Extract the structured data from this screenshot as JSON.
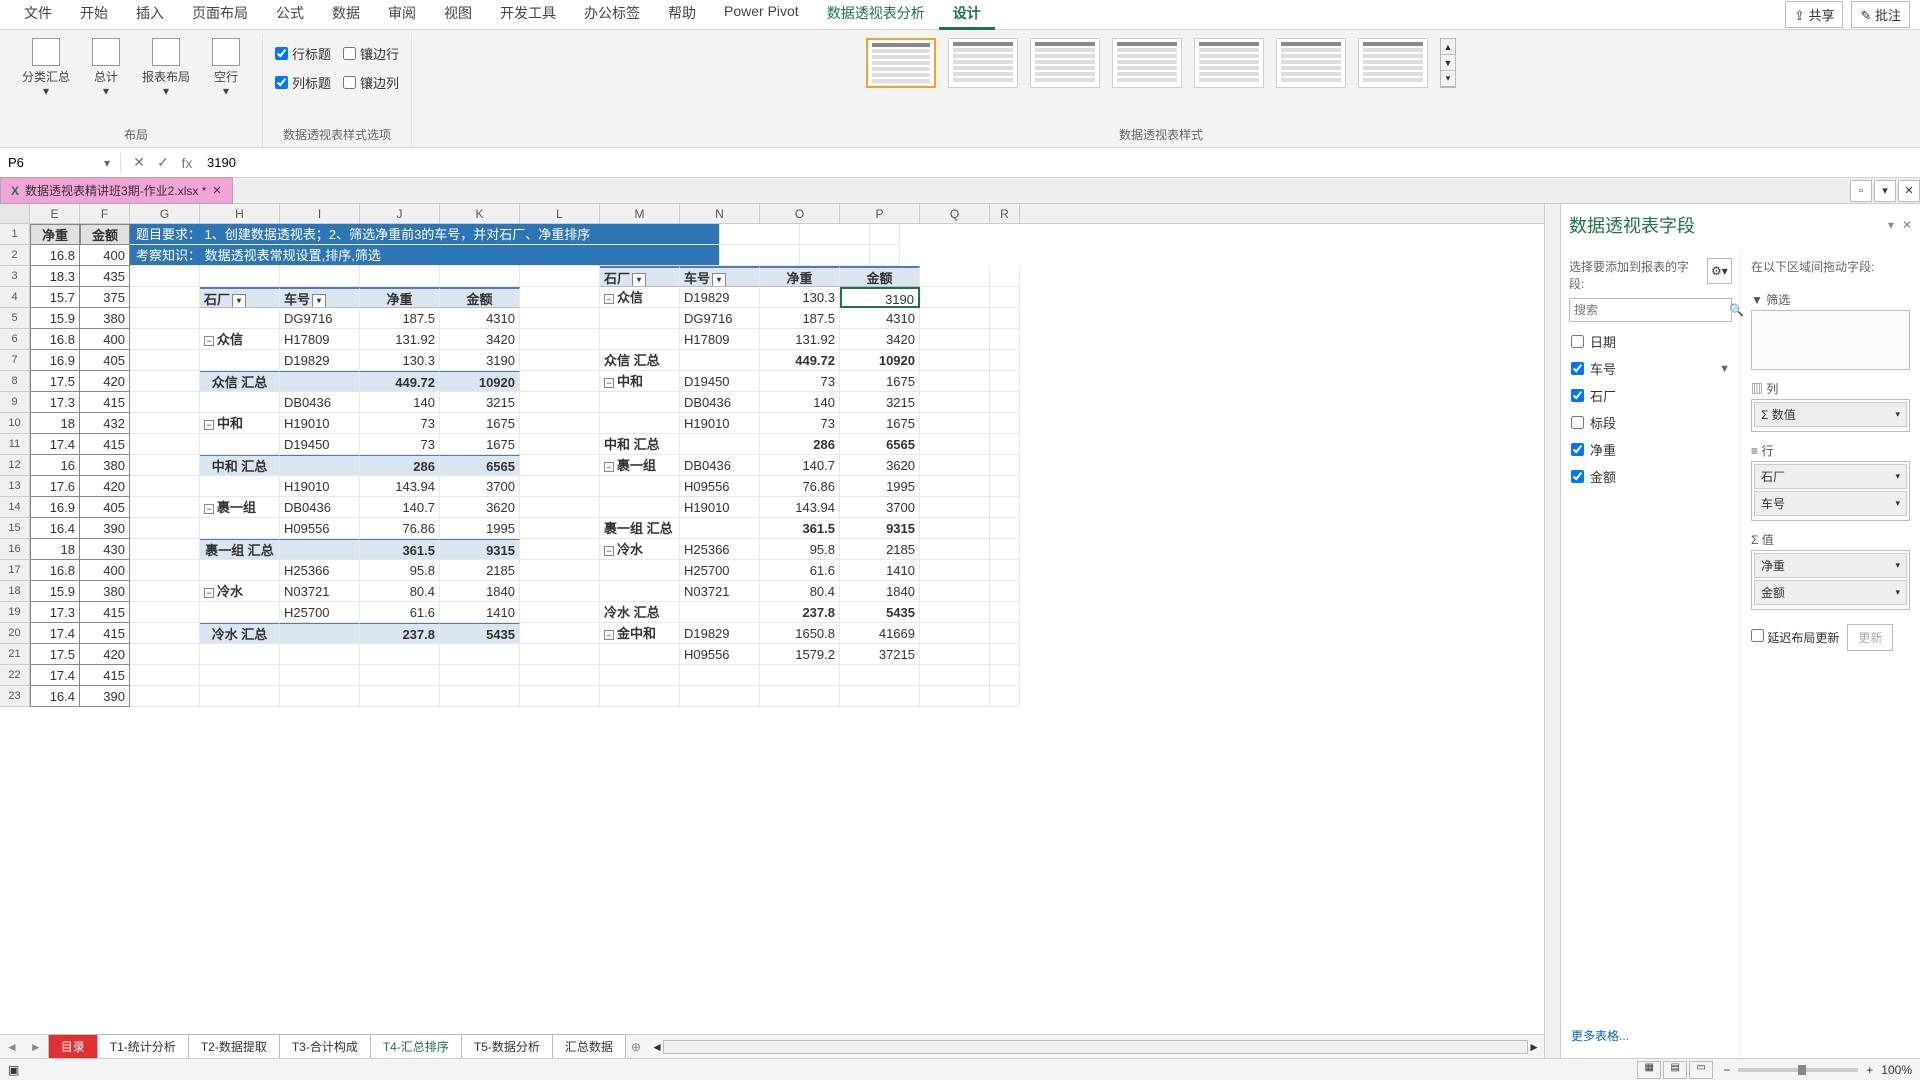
{
  "ribbon": {
    "tabs": [
      "文件",
      "开始",
      "插入",
      "页面布局",
      "公式",
      "数据",
      "审阅",
      "视图",
      "开发工具",
      "办公标签",
      "帮助",
      "Power Pivot",
      "数据透视表分析",
      "设计"
    ],
    "active_tab": "设计",
    "share": "共享",
    "annotate": "批注",
    "layout_group": "布局",
    "btns": {
      "subtotal": "分类汇总",
      "grand": "总计",
      "report": "报表布局",
      "blank": "空行"
    },
    "opts_group": "数据透视表样式选项",
    "opts": {
      "row_hdr": "行标题",
      "col_hdr": "列标题",
      "band_row": "镶边行",
      "band_col": "镶边列"
    },
    "styles_group": "数据透视表样式"
  },
  "formula": {
    "name": "P6",
    "fx": "fx",
    "value": "3190"
  },
  "doc_tab": "数据透视表精讲班3期-作业2.xlsx *",
  "cols": [
    "E",
    "F",
    "G",
    "H",
    "I",
    "J",
    "K",
    "L",
    "M",
    "N",
    "O",
    "P",
    "Q",
    "R"
  ],
  "colw": {
    "E": 50,
    "F": 50,
    "G": 70,
    "H": 80,
    "I": 80,
    "J": 80,
    "K": 80,
    "L": 80,
    "M": 80,
    "N": 80,
    "O": 80,
    "P": 80,
    "Q": 70,
    "R": 30
  },
  "left_hdr": {
    "E": "净重",
    "F": "金额"
  },
  "blue1": "题目要求：   1、创建数据透视表；2、筛选净重前3的车号，并对石厂、净重排序",
  "blue2": "考察知识：   数据透视表常规设置,排序,筛选",
  "left_rows": [
    [
      16.8,
      400
    ],
    [
      18.3,
      435
    ],
    [
      15.7,
      375
    ],
    [
      15.9,
      380
    ],
    [
      16.8,
      400
    ],
    [
      16.9,
      405
    ],
    [
      17.5,
      420
    ],
    [
      17.3,
      415
    ],
    [
      18,
      432
    ],
    [
      17.4,
      415
    ],
    [
      16,
      380
    ],
    [
      17.6,
      420
    ],
    [
      16.9,
      405
    ],
    [
      16.4,
      390
    ],
    [
      18,
      430
    ],
    [
      16.8,
      400
    ],
    [
      15.9,
      380
    ],
    [
      17.3,
      415
    ],
    [
      17.4,
      415
    ],
    [
      17.5,
      420
    ],
    [
      17.4,
      415
    ],
    [
      16.4,
      390
    ]
  ],
  "pt1": {
    "hdr": {
      "f1": "石厂",
      "f2": "车号",
      "v1": "净重",
      "v2": "金额"
    },
    "groups": [
      {
        "name": "众信",
        "rows": [
          [
            "DG9716",
            187.5,
            4310
          ],
          [
            "H17809",
            131.92,
            3420
          ],
          [
            "D19829",
            130.3,
            3190
          ]
        ],
        "sub": [
          "众信 汇总",
          449.72,
          10920
        ]
      },
      {
        "name": "中和",
        "rows": [
          [
            "DB0436",
            140,
            3215
          ],
          [
            "H19010",
            73,
            1675
          ],
          [
            "D19450",
            73,
            1675
          ]
        ],
        "sub": [
          "中和 汇总",
          286,
          6565
        ]
      },
      {
        "name": "裹一组",
        "rows": [
          [
            "H19010",
            143.94,
            3700
          ],
          [
            "DB0436",
            140.7,
            3620
          ],
          [
            "H09556",
            76.86,
            1995
          ]
        ],
        "sub": [
          "裹一组 汇总",
          361.5,
          9315
        ]
      },
      {
        "name": "冷水",
        "rows": [
          [
            "H25366",
            95.8,
            2185
          ],
          [
            "N03721",
            80.4,
            1840
          ],
          [
            "H25700",
            61.6,
            1410
          ]
        ],
        "sub": [
          "冷水 汇总",
          237.8,
          5435
        ]
      }
    ]
  },
  "pt2": {
    "hdr": {
      "f1": "石厂",
      "f2": "车号",
      "v1": "净重",
      "v2": "金额"
    },
    "groups": [
      {
        "name": "众信",
        "rows": [
          [
            "D19829",
            130.3,
            3190
          ],
          [
            "DG9716",
            187.5,
            4310
          ],
          [
            "H17809",
            131.92,
            3420
          ]
        ],
        "sub": [
          "众信 汇总",
          449.72,
          10920
        ]
      },
      {
        "name": "中和",
        "rows": [
          [
            "D19450",
            73,
            1675
          ],
          [
            "DB0436",
            140,
            3215
          ],
          [
            "H19010",
            73,
            1675
          ]
        ],
        "sub": [
          "中和 汇总",
          286,
          6565
        ]
      },
      {
        "name": "裹一组",
        "rows": [
          [
            "DB0436",
            140.7,
            3620
          ],
          [
            "H09556",
            76.86,
            1995
          ],
          [
            "H19010",
            143.94,
            3700
          ]
        ],
        "sub": [
          "裹一组 汇总",
          361.5,
          9315
        ]
      },
      {
        "name": "冷水",
        "rows": [
          [
            "H25366",
            95.8,
            2185
          ],
          [
            "H25700",
            61.6,
            1410
          ],
          [
            "N03721",
            80.4,
            1840
          ]
        ],
        "sub": [
          "冷水 汇总",
          237.8,
          5435
        ]
      },
      {
        "name": "金中和",
        "rows": [
          [
            "D19829",
            1650.8,
            41669
          ],
          [
            "H09556",
            1579.2,
            37215
          ]
        ],
        "sub": null
      }
    ]
  },
  "sheet_tabs": [
    "目录",
    "T1-统计分析",
    "T2-数据提取",
    "T3-合计构成",
    "T4-汇总排序",
    "T5-数据分析",
    "汇总数据"
  ],
  "active_sheet": "T4-汇总排序",
  "red_sheet": "目录",
  "field_pane": {
    "title": "数据透视表字段",
    "sub": "选择要添加到报表的字段:",
    "search_ph": "搜索",
    "fields": [
      {
        "n": "日期",
        "c": false
      },
      {
        "n": "车号",
        "c": true,
        "f": true
      },
      {
        "n": "石厂",
        "c": true
      },
      {
        "n": "标段",
        "c": false
      },
      {
        "n": "净重",
        "c": true
      },
      {
        "n": "金额",
        "c": true
      }
    ],
    "more": "更多表格...",
    "drag_label": "在以下区域间拖动字段:",
    "areas": {
      "filter": "筛选",
      "cols": "列",
      "rows": "行",
      "vals": "值"
    },
    "cols_items": [
      "Σ 数值"
    ],
    "rows_items": [
      "石厂",
      "车号"
    ],
    "vals_items": [
      "净重",
      "金额"
    ],
    "defer": "延迟布局更新",
    "update": "更新"
  },
  "status": {
    "zoom": "100%"
  }
}
